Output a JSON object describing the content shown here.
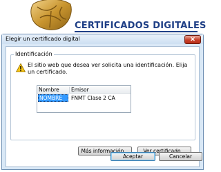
{
  "banner": {
    "title": "CERTIFICADOS DIGITALES"
  },
  "dialog": {
    "title": "Elegir un certificado digital",
    "close_label": "✕",
    "group_label": "Identificación",
    "message": "El sitio web que desea ver solicita una identificación. Elija un certificado.",
    "table": {
      "columns": [
        "Nombre",
        "Emisor"
      ],
      "rows": [
        {
          "name": "NOMBRE",
          "issuer": "FNMT Clase 2 CA"
        }
      ]
    },
    "buttons": {
      "more_info": "Más información...",
      "view_cert": "Ver certificado...",
      "accept": "Aceptar",
      "cancel": "Cancelar"
    }
  },
  "colors": {
    "banner_text": "#1f3f86",
    "dialog_bg": "#d9e8f6",
    "selection": "#3399ff",
    "close_button": "#c8402a"
  },
  "icons": [
    "smartcard-chip-logo",
    "warning-icon",
    "close-icon"
  ]
}
